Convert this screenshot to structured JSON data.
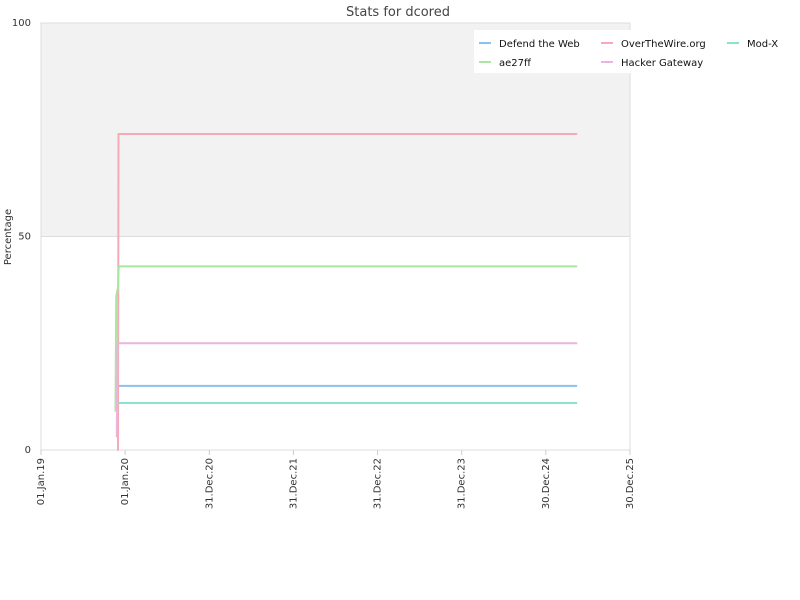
{
  "chart_data": {
    "type": "line",
    "title": "Stats for dcored",
    "xlabel": "",
    "ylabel": "Percentage",
    "ylim": [
      0,
      100
    ],
    "xlim": [
      "2019-01-01",
      "2025-12-30"
    ],
    "y_ticks": [
      0,
      50,
      100
    ],
    "x_ticks": [
      {
        "date": "2019-01-01",
        "label": "01.Jan.19"
      },
      {
        "date": "2020-01-01",
        "label": "01.Jan.20"
      },
      {
        "date": "2020-12-31",
        "label": "31.Dec.20"
      },
      {
        "date": "2021-12-31",
        "label": "31.Dec.21"
      },
      {
        "date": "2022-12-31",
        "label": "31.Dec.22"
      },
      {
        "date": "2023-12-31",
        "label": "31.Dec.23"
      },
      {
        "date": "2024-12-30",
        "label": "30.Dec.24"
      },
      {
        "date": "2025-12-30",
        "label": "30.Dec.25"
      }
    ],
    "shaded_band": {
      "from": 50,
      "to": 100,
      "color": "#f2f2f2"
    },
    "grid": true,
    "legend_position": "top-right",
    "series": [
      {
        "name": "Defend the Web",
        "color": "#8cc1ee",
        "points": [
          {
            "x": "2019-11-20",
            "y": 10
          },
          {
            "x": "2019-11-28",
            "y": 15
          },
          {
            "x": "2025-05-15",
            "y": 15
          }
        ]
      },
      {
        "name": "OverTheWire.org",
        "color": "#f6a9b6",
        "points": [
          {
            "x": "2019-11-28",
            "y": 0
          },
          {
            "x": "2019-12-01",
            "y": 0
          },
          {
            "x": "2019-12-03",
            "y": 74
          },
          {
            "x": "2025-05-15",
            "y": 74
          }
        ]
      },
      {
        "name": "Mod-X",
        "color": "#8ee0cf",
        "points": [
          {
            "x": "2019-11-20",
            "y": 9
          },
          {
            "x": "2019-11-24",
            "y": 11
          },
          {
            "x": "2025-05-15",
            "y": 11
          }
        ]
      },
      {
        "name": "ae27ff",
        "color": "#a9e6a0",
        "points": [
          {
            "x": "2019-11-20",
            "y": 9
          },
          {
            "x": "2019-11-23",
            "y": 36
          },
          {
            "x": "2019-12-01",
            "y": 38
          },
          {
            "x": "2019-12-04",
            "y": 43
          },
          {
            "x": "2025-05-15",
            "y": 43
          }
        ]
      },
      {
        "name": "Hacker Gateway",
        "color": "#eab4dd",
        "points": [
          {
            "x": "2019-11-26",
            "y": 3
          },
          {
            "x": "2019-11-29",
            "y": 25
          },
          {
            "x": "2025-05-15",
            "y": 25
          }
        ]
      }
    ]
  }
}
